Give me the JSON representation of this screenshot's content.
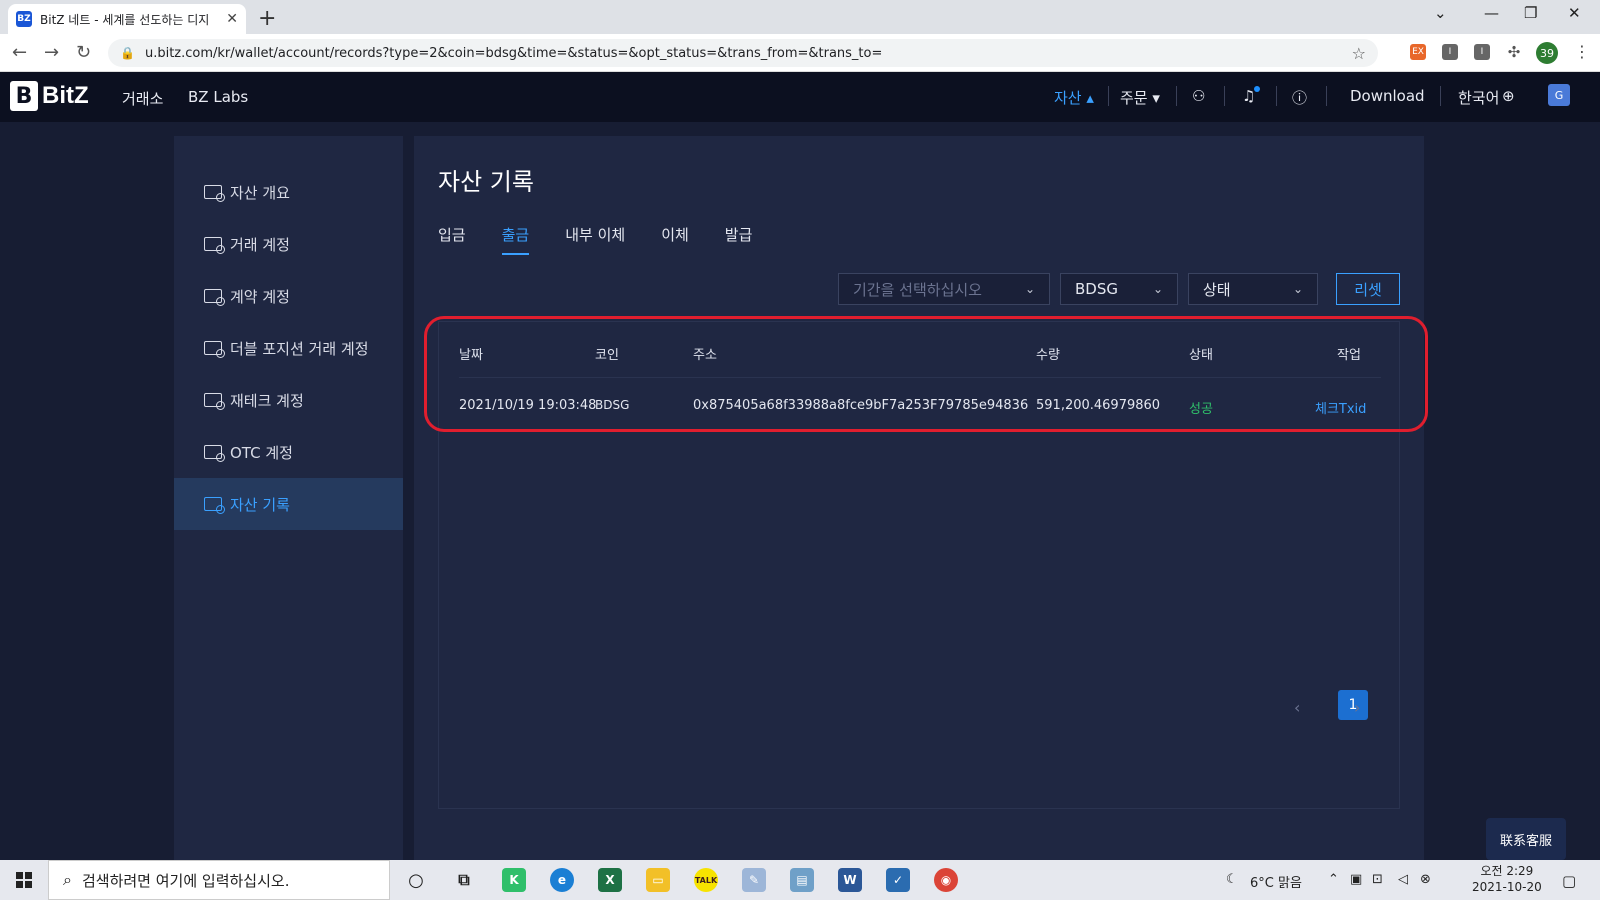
{
  "browser": {
    "tab_title": "BitZ 네트 - 세계를 선도하는 디지",
    "tab_favicon": "BZ",
    "url": "u.bitz.com/kr/wallet/account/records?type=2&coin=bdsg&time=&status=&opt_status=&trans_from=&trans_to=",
    "profile_badge": "39",
    "ext1": "EX",
    "ext2": "I",
    "ext3": "I"
  },
  "header": {
    "logo_mark": "B",
    "logo_text": "BitZ",
    "nav": [
      "거래소",
      "BZ Labs"
    ],
    "assets_menu": "자산 ▴",
    "orders_menu": "주문 ▾",
    "download": "Download",
    "language": "한국어"
  },
  "sidebar": {
    "items": [
      {
        "label": "자산 개요"
      },
      {
        "label": "거래 계정"
      },
      {
        "label": "계약 계정"
      },
      {
        "label": "더블 포지션 거래 계정"
      },
      {
        "label": "재테크 계정"
      },
      {
        "label": "OTC 계정"
      },
      {
        "label": "자산 기록"
      }
    ]
  },
  "main": {
    "title": "자산 기록",
    "tabs": [
      "입금",
      "출금",
      "내부 이체",
      "이체",
      "발급"
    ],
    "active_tab": "출금",
    "filters": {
      "period_placeholder": "기간을 선택하십시오",
      "coin": "BDSG",
      "status": "상태",
      "reset": "리셋"
    },
    "table": {
      "headers": [
        "날짜",
        "코인",
        "주소",
        "수량",
        "상태",
        "작업"
      ],
      "rows": [
        {
          "date": "2021/10/19 19:03:48",
          "coin": "BDSG",
          "address": "0x875405a68f33988a8fce9bF7a253F79785e94836",
          "amount": "591,200.46979860",
          "status": "성공",
          "action": "체크Txid"
        }
      ]
    },
    "pagination": {
      "current": "1"
    }
  },
  "support_button": "联系客服",
  "taskbar": {
    "search_placeholder": "검색하려면 여기에 입력하십시오.",
    "weather": "6°C 맑음",
    "time": "오전 2:29",
    "date": "2021-10-20"
  },
  "colors": {
    "accent": "#3aa0ff",
    "success": "#2fbf6a",
    "highlight": "#e01e2e",
    "panel": "#1f2742"
  }
}
